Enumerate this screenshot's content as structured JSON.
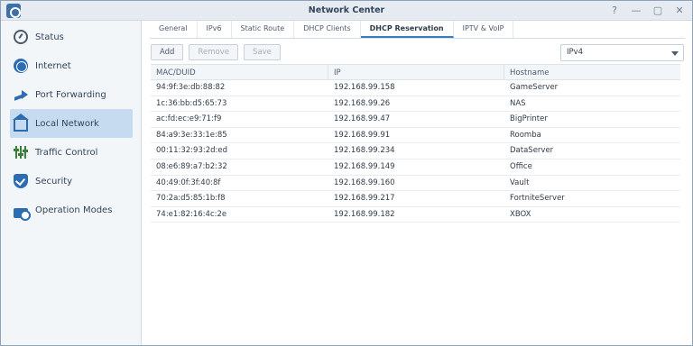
{
  "window": {
    "title": "Network Center",
    "controls": [
      "?",
      "—",
      "▢",
      "✕"
    ]
  },
  "sidebar": {
    "items": [
      {
        "label": "Status",
        "icon": "gauge-icon",
        "active": false
      },
      {
        "label": "Internet",
        "icon": "globe-icon",
        "active": false
      },
      {
        "label": "Port Forwarding",
        "icon": "arrow-icon",
        "active": false
      },
      {
        "label": "Local Network",
        "icon": "home-icon",
        "active": true
      },
      {
        "label": "Traffic Control",
        "icon": "sliders-icon",
        "active": false
      },
      {
        "label": "Security",
        "icon": "shield-icon",
        "active": false
      },
      {
        "label": "Operation Modes",
        "icon": "router-icon",
        "active": false
      }
    ]
  },
  "tabs": [
    {
      "label": "General",
      "active": false
    },
    {
      "label": "IPv6",
      "active": false
    },
    {
      "label": "Static Route",
      "active": false
    },
    {
      "label": "DHCP Clients",
      "active": false
    },
    {
      "label": "DHCP Reservation",
      "active": true
    },
    {
      "label": "IPTV & VoIP",
      "active": false
    }
  ],
  "toolbar": {
    "add_label": "Add",
    "remove_label": "Remove",
    "save_label": "Save",
    "ip_version": "IPv4"
  },
  "table": {
    "columns": [
      "MAC/DUID",
      "IP",
      "Hostname"
    ],
    "rows": [
      [
        "94:9f:3e:db:88:82",
        "192.168.99.158",
        "GameServer"
      ],
      [
        "1c:36:bb:d5:65:73",
        "192.168.99.26",
        "NAS"
      ],
      [
        "ac:fd:ec:e9:71:f9",
        "192.168.99.47",
        "BigPrinter"
      ],
      [
        "84:a9:3e:33:1e:85",
        "192.168.99.91",
        "Roomba"
      ],
      [
        "00:11:32:93:2d:ed",
        "192.168.99.234",
        "DataServer"
      ],
      [
        "08:e6:89:a7:b2:32",
        "192.168.99.149",
        "Office"
      ],
      [
        "40:49:0f:3f:40:8f",
        "192.168.99.160",
        "Vault"
      ],
      [
        "70:2a:d5:85:1b:f8",
        "192.168.99.217",
        "FortniteServer"
      ],
      [
        "74:e1:82:16:4c:2e",
        "192.168.99.182",
        "XBOX"
      ]
    ]
  },
  "colors": {
    "accent": "#3b7bbf",
    "active_nav_bg": "#c6daf0",
    "sidebar_bg": "#f3f6f9"
  }
}
